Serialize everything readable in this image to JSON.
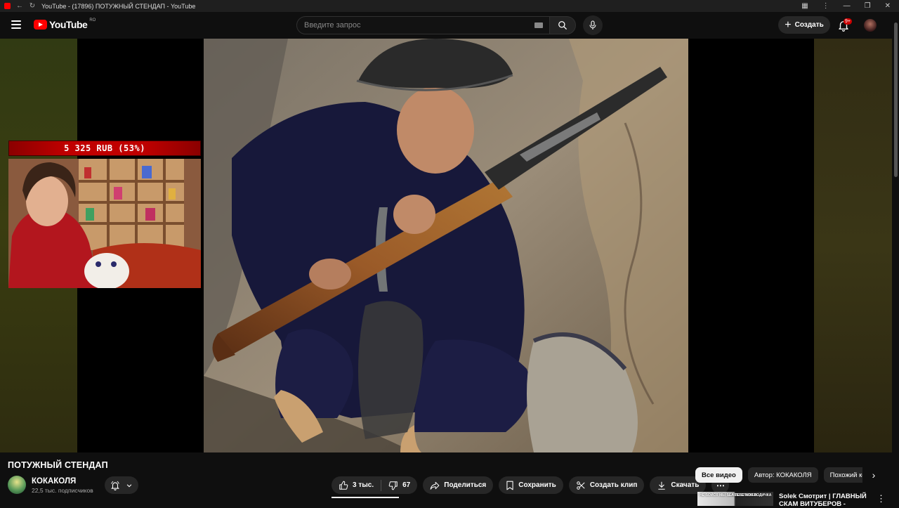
{
  "window": {
    "title": "YouTube - (17896) ПОТУЖНЫЙ СТЕНДАП - YouTube"
  },
  "masthead": {
    "logo_text": "YouTube",
    "country_code": "RO",
    "search_placeholder": "Введите запрос",
    "create_label": "Создать",
    "notification_count": "9+"
  },
  "overlay": {
    "donation_text": "5 325 RUB (53%)"
  },
  "video": {
    "title": "ПОТУЖНЫЙ СТЕНДАП",
    "channel_name": "КОКАКОЛЯ",
    "subscribers": "22,5 тыс. подписчиков"
  },
  "actions": {
    "likes": "3 тыс.",
    "dislikes": "67",
    "share": "Поделиться",
    "save": "Сохранить",
    "clip": "Создать клип",
    "download": "Скачать"
  },
  "chips": [
    "Все видео",
    "Автор: КОКАКОЛЯ",
    "Похожий контент"
  ],
  "recommendation": {
    "thumb_left_text": "НЕ БОЙСЯ МЫ БЕЛЫЕ СТАЛКЕР...",
    "thumb_right_text": "А ТЕБЕ МОЯ ВОДИЧКА",
    "title": "Solek Смотрит | ГЛАВНЫЙ СКАМ ВИТУБЕРОВ -"
  },
  "colors": {
    "youtube_red": "#ff0000",
    "donation_red": "#c00000",
    "background": "#0f0f0f",
    "pill": "#272727"
  }
}
